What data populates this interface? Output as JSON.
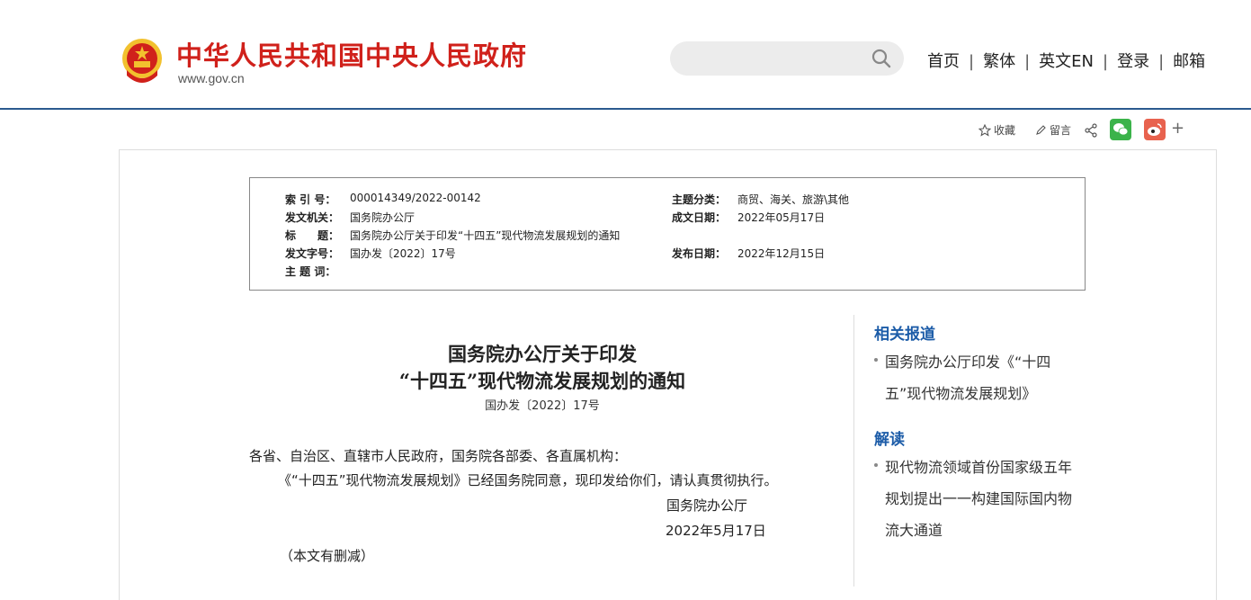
{
  "site": {
    "title": "中华人民共和国中央人民政府",
    "url": "www.gov.cn"
  },
  "search": {
    "placeholder": ""
  },
  "nav": {
    "home": "首页",
    "traditional": "繁体",
    "english": "英文EN",
    "login": "登录",
    "mail": "邮箱",
    "separator": "|"
  },
  "share": {
    "favorite": "收藏",
    "comment": "留言",
    "more": "+"
  },
  "meta": {
    "index_label": "索 引 号：",
    "index_value": "000014349/2022-00142",
    "category_label": "主题分类：",
    "category_value": "商贸、海关、旅游\\其他",
    "issuer_label": "发文机关：",
    "issuer_value": "国务院办公厅",
    "written_label": "成文日期：",
    "written_value": "2022年05月17日",
    "title_label": "标　　题：",
    "title_value": "国务院办公厅关于印发“十四五”现代物流发展规划的通知",
    "docno_label": "发文字号：",
    "docno_value": "国办发〔2022〕17号",
    "published_label": "发布日期：",
    "published_value": "2022年12月15日",
    "keywords_label": "主 题 词："
  },
  "article": {
    "title_line1": "国务院办公厅关于印发",
    "title_line2": "“十四五”现代物流发展规划的通知",
    "doc_number": "国办发〔2022〕17号",
    "salutation": "各省、自治区、直辖市人民政府，国务院各部委、各直属机构：",
    "body": "《“十四五”现代物流发展规划》已经国务院同意，现印发给你们，请认真贯彻执行。",
    "signature": "国务院办公厅",
    "date": "2022年5月17日",
    "note": "（本文有删减）"
  },
  "sidebar": {
    "related_heading": "相关报道",
    "related_items": [
      "国务院办公厅印发《“十四",
      "五”现代物流发展规划》"
    ],
    "interpret_heading": "解读",
    "interpret_items": [
      "现代物流领域首份国家级五年",
      "规划提出一一构建国际国内物",
      "流大通道"
    ]
  },
  "colors": {
    "brand_red": "#d0211b",
    "header_rule": "#2b5a8f",
    "link_blue": "#1c5ca8",
    "wechat_green": "#3bb34a",
    "weibo_red": "#e8624e"
  },
  "icons": [
    "national-emblem-icon",
    "search-icon",
    "star-icon",
    "pen-icon",
    "share-icon",
    "wechat-icon",
    "weibo-icon",
    "plus-icon"
  ]
}
